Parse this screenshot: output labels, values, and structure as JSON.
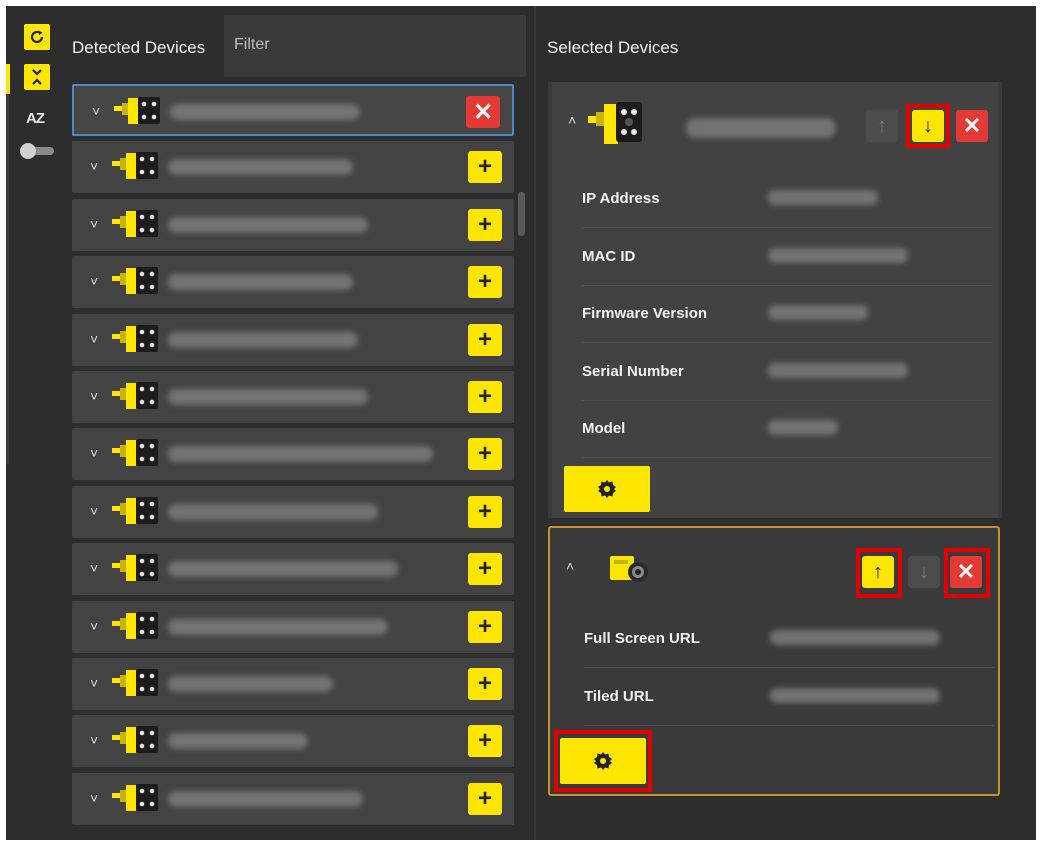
{
  "toolbar": {
    "refresh_icon": "refresh-icon",
    "collapse_icon": "collapse-all-icon",
    "sort_label": "AZ"
  },
  "detected": {
    "title": "Detected Devices",
    "filter_placeholder": "Filter",
    "devices": [
      {
        "name": "",
        "selected": true,
        "action": "remove"
      },
      {
        "name": "",
        "selected": false,
        "action": "add"
      },
      {
        "name": "",
        "selected": false,
        "action": "add"
      },
      {
        "name": "",
        "selected": false,
        "action": "add"
      },
      {
        "name": "",
        "selected": false,
        "action": "add"
      },
      {
        "name": "",
        "selected": false,
        "action": "add"
      },
      {
        "name": "",
        "selected": false,
        "action": "add"
      },
      {
        "name": "",
        "selected": false,
        "action": "add"
      },
      {
        "name": "",
        "selected": false,
        "action": "add"
      },
      {
        "name": "",
        "selected": false,
        "action": "add"
      },
      {
        "name": "",
        "selected": false,
        "action": "add"
      },
      {
        "name": "",
        "selected": false,
        "action": "add"
      },
      {
        "name": "",
        "selected": false,
        "action": "add"
      }
    ],
    "add_symbol": "+",
    "remove_symbol": "✕"
  },
  "selected": {
    "title": "Selected Devices",
    "device1": {
      "properties": [
        {
          "label": "IP Address"
        },
        {
          "label": "MAC ID"
        },
        {
          "label": "Firmware Version"
        },
        {
          "label": "Serial Number"
        },
        {
          "label": "Model"
        }
      ]
    },
    "device2": {
      "properties": [
        {
          "label": "Full Screen URL"
        },
        {
          "label": "Tiled URL"
        }
      ]
    },
    "up_symbol": "↑",
    "down_symbol": "↓",
    "remove_symbol": "✕"
  },
  "colors": {
    "accent": "#ffe600",
    "danger": "#e53935",
    "highlight": "#e00000",
    "panel": "#2d2d2d",
    "card_border": "#c4912f"
  }
}
